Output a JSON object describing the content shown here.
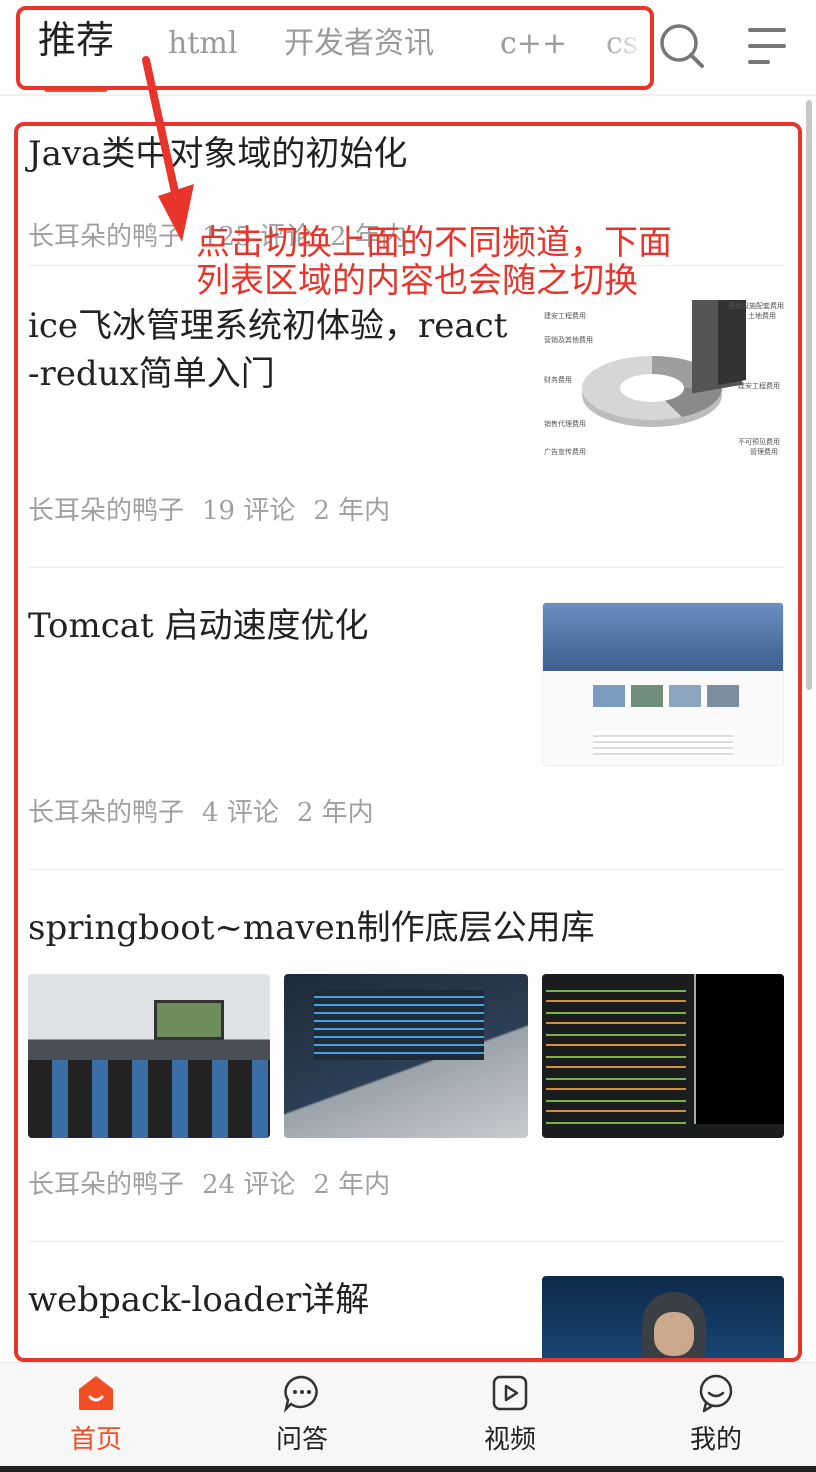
{
  "top_nav": {
    "channels": [
      "推荐",
      "html",
      "开发者资讯",
      "c++",
      "cs"
    ],
    "active_channel": "推荐"
  },
  "annotation": {
    "text_line1": "点击切换上面的不同频道，下面",
    "text_line2": "列表区域的内容也会随之切换",
    "color": "#e8342a"
  },
  "articles": [
    {
      "title": "Java类中对象域的初始化",
      "author": "长耳朵的鸭子",
      "comments": "125 评论",
      "time": "2 年内"
    },
    {
      "title": "ice飞冰管理系统初体验，react-redux简单入门",
      "title_line1": "ice飞冰管理系统初体验，react",
      "title_line2": "-redux简单入门",
      "author": "长耳朵的鸭子",
      "comments": "19 评论",
      "time": "2 年内",
      "thumb": "pie-chart-image"
    },
    {
      "title": "Tomcat 启动速度优化",
      "author": "长耳朵的鸭子",
      "comments": "4 评论",
      "time": "2 年内",
      "thumb": "website-screenshot-image"
    },
    {
      "title": "springboot~maven制作底层公用库",
      "author": "长耳朵的鸭子",
      "comments": "24 评论",
      "time": "2 年内",
      "thumbs": [
        "classroom-photo",
        "laptop-code-photo",
        "terminal-code-screenshot"
      ]
    },
    {
      "title": "webpack-loader详解",
      "thumb": "hacker-photo"
    }
  ],
  "pie_labels": [
    "建安工程费用",
    "营销及其他费用",
    "财务费用",
    "销售代理费用",
    "广告宣传费用",
    "基础设施配套费用",
    "土地费用",
    "建安工程费用",
    "不可预见费用",
    "管理费用"
  ],
  "tab_bar": {
    "tabs": [
      {
        "label": "首页",
        "icon": "home-icon",
        "active": true
      },
      {
        "label": "问答",
        "icon": "chat-icon",
        "active": false
      },
      {
        "label": "视频",
        "icon": "video-icon",
        "active": false
      },
      {
        "label": "我的",
        "icon": "profile-icon",
        "active": false
      }
    ]
  },
  "colors": {
    "accent": "#f04e23",
    "annotation": "#e8342a",
    "meta_text": "#a0a0a0"
  }
}
